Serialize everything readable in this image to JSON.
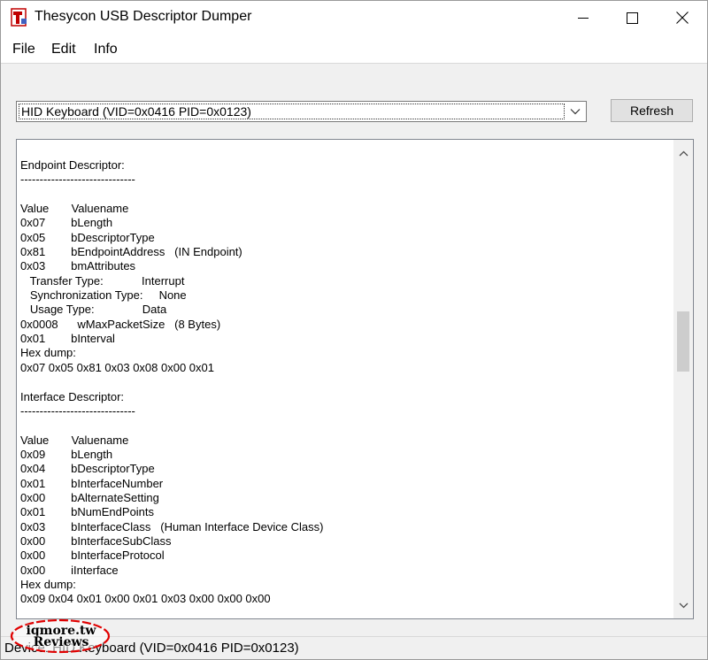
{
  "window": {
    "title": "Thesycon USB Descriptor Dumper",
    "icon": "usb-app-icon",
    "controls": [
      "minimize-icon",
      "maximize-icon",
      "close-icon"
    ]
  },
  "menu": {
    "items": [
      {
        "label": "File"
      },
      {
        "label": "Edit"
      },
      {
        "label": "Info"
      }
    ]
  },
  "device_select": {
    "value": "HID Keyboard (VID=0x0416 PID=0x0123)"
  },
  "refresh_button": {
    "label": "Refresh"
  },
  "descriptor_text": {
    "lines": [
      "Endpoint Descriptor:",
      "------------------------------",
      "",
      "Value       Valuename",
      "0x07        bLength",
      "0x05        bDescriptorType",
      "0x81        bEndpointAddress   (IN Endpoint)",
      "0x03        bmAttributes",
      "   Transfer Type:            Interrupt",
      "   Synchronization Type:     None",
      "   Usage Type:               Data",
      "0x0008      wMaxPacketSize   (8 Bytes)",
      "0x01        bInterval",
      "Hex dump:",
      "0x07 0x05 0x81 0x03 0x08 0x00 0x01",
      "",
      "Interface Descriptor:",
      "------------------------------",
      "",
      "Value       Valuename",
      "0x09        bLength",
      "0x04        bDescriptorType",
      "0x01        bInterfaceNumber",
      "0x00        bAlternateSetting",
      "0x01        bNumEndPoints",
      "0x03        bInterfaceClass   (Human Interface Device Class)",
      "0x00        bInterfaceSubClass",
      "0x00        bInterfaceProtocol",
      "0x00        iInterface",
      "Hex dump:",
      "0x09 0x04 0x01 0x00 0x01 0x03 0x00 0x00 0x00"
    ],
    "scroll_position": 0.65
  },
  "status_bar": {
    "text": "Device: HID Keyboard (VID=0x0416 PID=0x0123)"
  },
  "watermark": {
    "line1": "iqmore.tw",
    "line2": "Reviews",
    "ring_color": "#e00000"
  }
}
